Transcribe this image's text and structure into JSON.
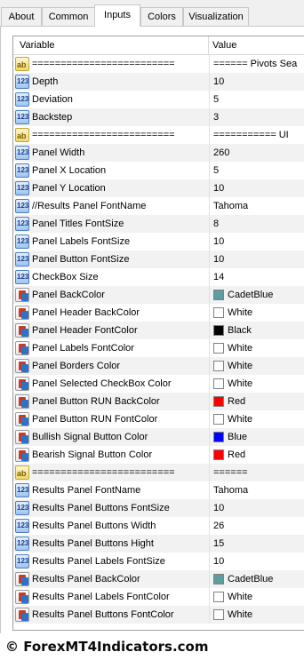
{
  "tabs": [
    "About",
    "Common",
    "Inputs",
    "Colors",
    "Visualization"
  ],
  "active_tab": "Inputs",
  "columns": {
    "variable": "Variable",
    "value": "Value"
  },
  "rows": [
    {
      "type": "string",
      "name": "=========================",
      "value": "====== Pivots Sea"
    },
    {
      "type": "number",
      "name": "Depth",
      "value": "10"
    },
    {
      "type": "number",
      "name": "Deviation",
      "value": "5"
    },
    {
      "type": "number",
      "name": "Backstep",
      "value": "3"
    },
    {
      "type": "string",
      "name": "=========================",
      "value": "=========== UI"
    },
    {
      "type": "number",
      "name": "Panel Width",
      "value": "260"
    },
    {
      "type": "number",
      "name": "Panel X Location",
      "value": "5"
    },
    {
      "type": "number",
      "name": "Panel Y Location",
      "value": "10"
    },
    {
      "type": "number",
      "name": "//Results Panel FontName",
      "value": "Tahoma"
    },
    {
      "type": "number",
      "name": "Panel Titles FontSize",
      "value": "8"
    },
    {
      "type": "number",
      "name": "Panel Labels FontSize",
      "value": "10"
    },
    {
      "type": "number",
      "name": "Panel Button FontSize",
      "value": "10"
    },
    {
      "type": "number",
      "name": "CheckBox Size",
      "value": "14"
    },
    {
      "type": "color",
      "name": "Panel BackColor",
      "value": "CadetBlue",
      "color": "#5f9ea0"
    },
    {
      "type": "color",
      "name": "Panel Header BackColor",
      "value": "White",
      "color": "#ffffff"
    },
    {
      "type": "color",
      "name": "Panel Header FontColor",
      "value": "Black",
      "color": "#000000"
    },
    {
      "type": "color",
      "name": "Panel Labels FontColor",
      "value": "White",
      "color": "#ffffff"
    },
    {
      "type": "color",
      "name": "Panel Borders Color",
      "value": "White",
      "color": "#ffffff"
    },
    {
      "type": "color",
      "name": "Panel Selected CheckBox Color",
      "value": "White",
      "color": "#ffffff"
    },
    {
      "type": "color",
      "name": "Panel Button RUN BackColor",
      "value": "Red",
      "color": "#ff0000"
    },
    {
      "type": "color",
      "name": "Panel Button RUN FontColor",
      "value": "White",
      "color": "#ffffff"
    },
    {
      "type": "color",
      "name": "Bullish Signal Button Color",
      "value": "Blue",
      "color": "#0000ff"
    },
    {
      "type": "color",
      "name": "Bearish Signal Button Color",
      "value": "Red",
      "color": "#ff0000"
    },
    {
      "type": "string",
      "name": "=========================",
      "value": "======"
    },
    {
      "type": "number",
      "name": "Results Panel FontName",
      "value": "Tahoma"
    },
    {
      "type": "number",
      "name": "Results Panel Buttons FontSize",
      "value": "10"
    },
    {
      "type": "number",
      "name": "Results Panel Buttons Width",
      "value": "26"
    },
    {
      "type": "number",
      "name": "Results Panel Buttons Hight",
      "value": "15"
    },
    {
      "type": "number",
      "name": "Results Panel Labels FontSize",
      "value": "10"
    },
    {
      "type": "color",
      "name": "Results Panel BackColor",
      "value": "CadetBlue",
      "color": "#5f9ea0"
    },
    {
      "type": "color",
      "name": "Results Panel Labels FontColor",
      "value": "White",
      "color": "#ffffff"
    },
    {
      "type": "color",
      "name": "Results Panel Buttons FontColor",
      "value": "White",
      "color": "#ffffff"
    }
  ],
  "icons": {
    "string": "ab-string-icon",
    "number": "123-number-icon",
    "color": "color-palette-icon"
  },
  "icon_glyphs": {
    "string": "ab",
    "number": "123"
  },
  "footer": {
    "text": "© ForexMT4Indicators.com"
  }
}
